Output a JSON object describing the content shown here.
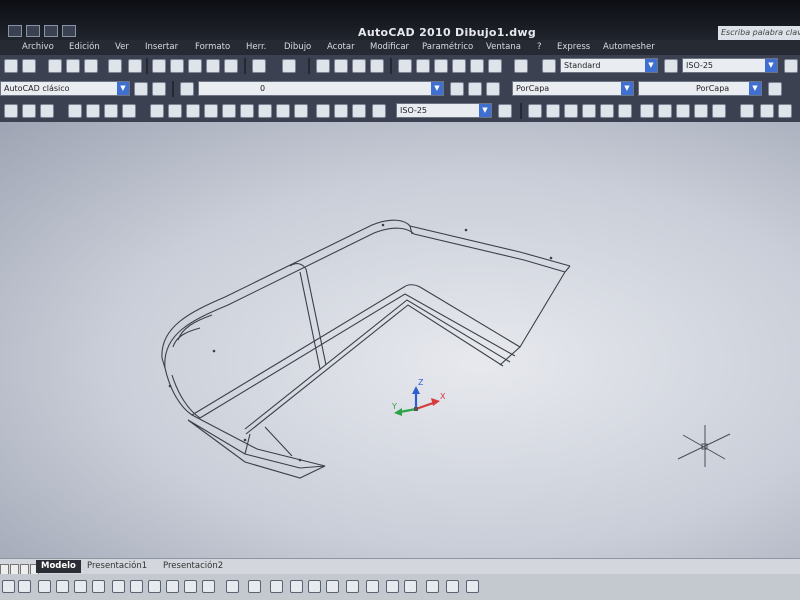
{
  "window": {
    "title": "AutoCAD 2010    Dibujo1.dwg",
    "search_placeholder": "Escriba palabra clave"
  },
  "menu": [
    "Archivo",
    "Edición",
    "Ver",
    "Insertar",
    "Formato",
    "Herr.",
    "Dibujo",
    "Acotar",
    "Modificar",
    "Paramétrico",
    "Ventana",
    "?",
    "Express",
    "Automesher"
  ],
  "toolbar": {
    "text_style": "Standard",
    "dim_style": "ISO-25",
    "workspace": "AutoCAD clásico",
    "layer": "0",
    "color": "PorCapa",
    "linetype": "PorCapa",
    "dim_style_2": "ISO-25"
  },
  "ucs": {
    "x_label": "X",
    "y_label": "Y",
    "z_label": "Z"
  },
  "layout_tabs": [
    "Modelo",
    "Presentación1",
    "Presentación2"
  ],
  "colors": {
    "axis_x": "#d63a3a",
    "axis_y": "#2fa24a",
    "axis_z": "#2e5fd1",
    "viewport_bg": "#dfe2e8"
  },
  "icons": [
    "new-icon",
    "open-icon",
    "save-icon",
    "plot-icon",
    "cut-icon",
    "copy-icon",
    "paste-icon",
    "undo-icon",
    "redo-icon",
    "pan-icon",
    "zoom-icon",
    "properties-icon",
    "layer-icon",
    "crosshair-cursor"
  ]
}
